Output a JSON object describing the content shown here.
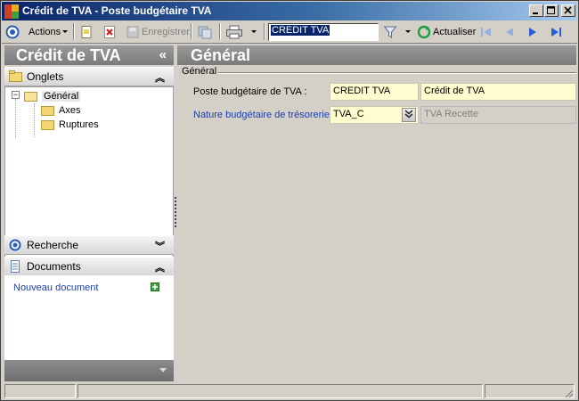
{
  "window": {
    "title": "Crédit de TVA - Poste budgétaire TVA"
  },
  "toolbar": {
    "actions_label": "Actions",
    "save_label": "Enregistrer",
    "search_value": "CREDIT TVA",
    "refresh_label": "Actualiser"
  },
  "left_panel": {
    "title": "Crédit de TVA",
    "tabs_header": "Onglets",
    "tree": {
      "root": "Général",
      "children": [
        "Axes",
        "Ruptures"
      ]
    },
    "search_header": "Recherche",
    "documents_header": "Documents",
    "new_document_link": "Nouveau document"
  },
  "main": {
    "title": "Général",
    "group_label": "Général",
    "fields": {
      "poste_label": "Poste budgétaire de TVA :",
      "poste_code": "CREDIT TVA",
      "poste_name": "Crédit de TVA",
      "nature_label": "Nature budgétaire de trésorerie :",
      "nature_code": "TVA_C",
      "nature_name": "TVA Recette"
    }
  },
  "colors": {
    "titlebar_start": "#0a246a",
    "panel_header": "#8a8a8a",
    "field_yellow": "#fffcd0",
    "link_blue": "#1a3fb0"
  }
}
